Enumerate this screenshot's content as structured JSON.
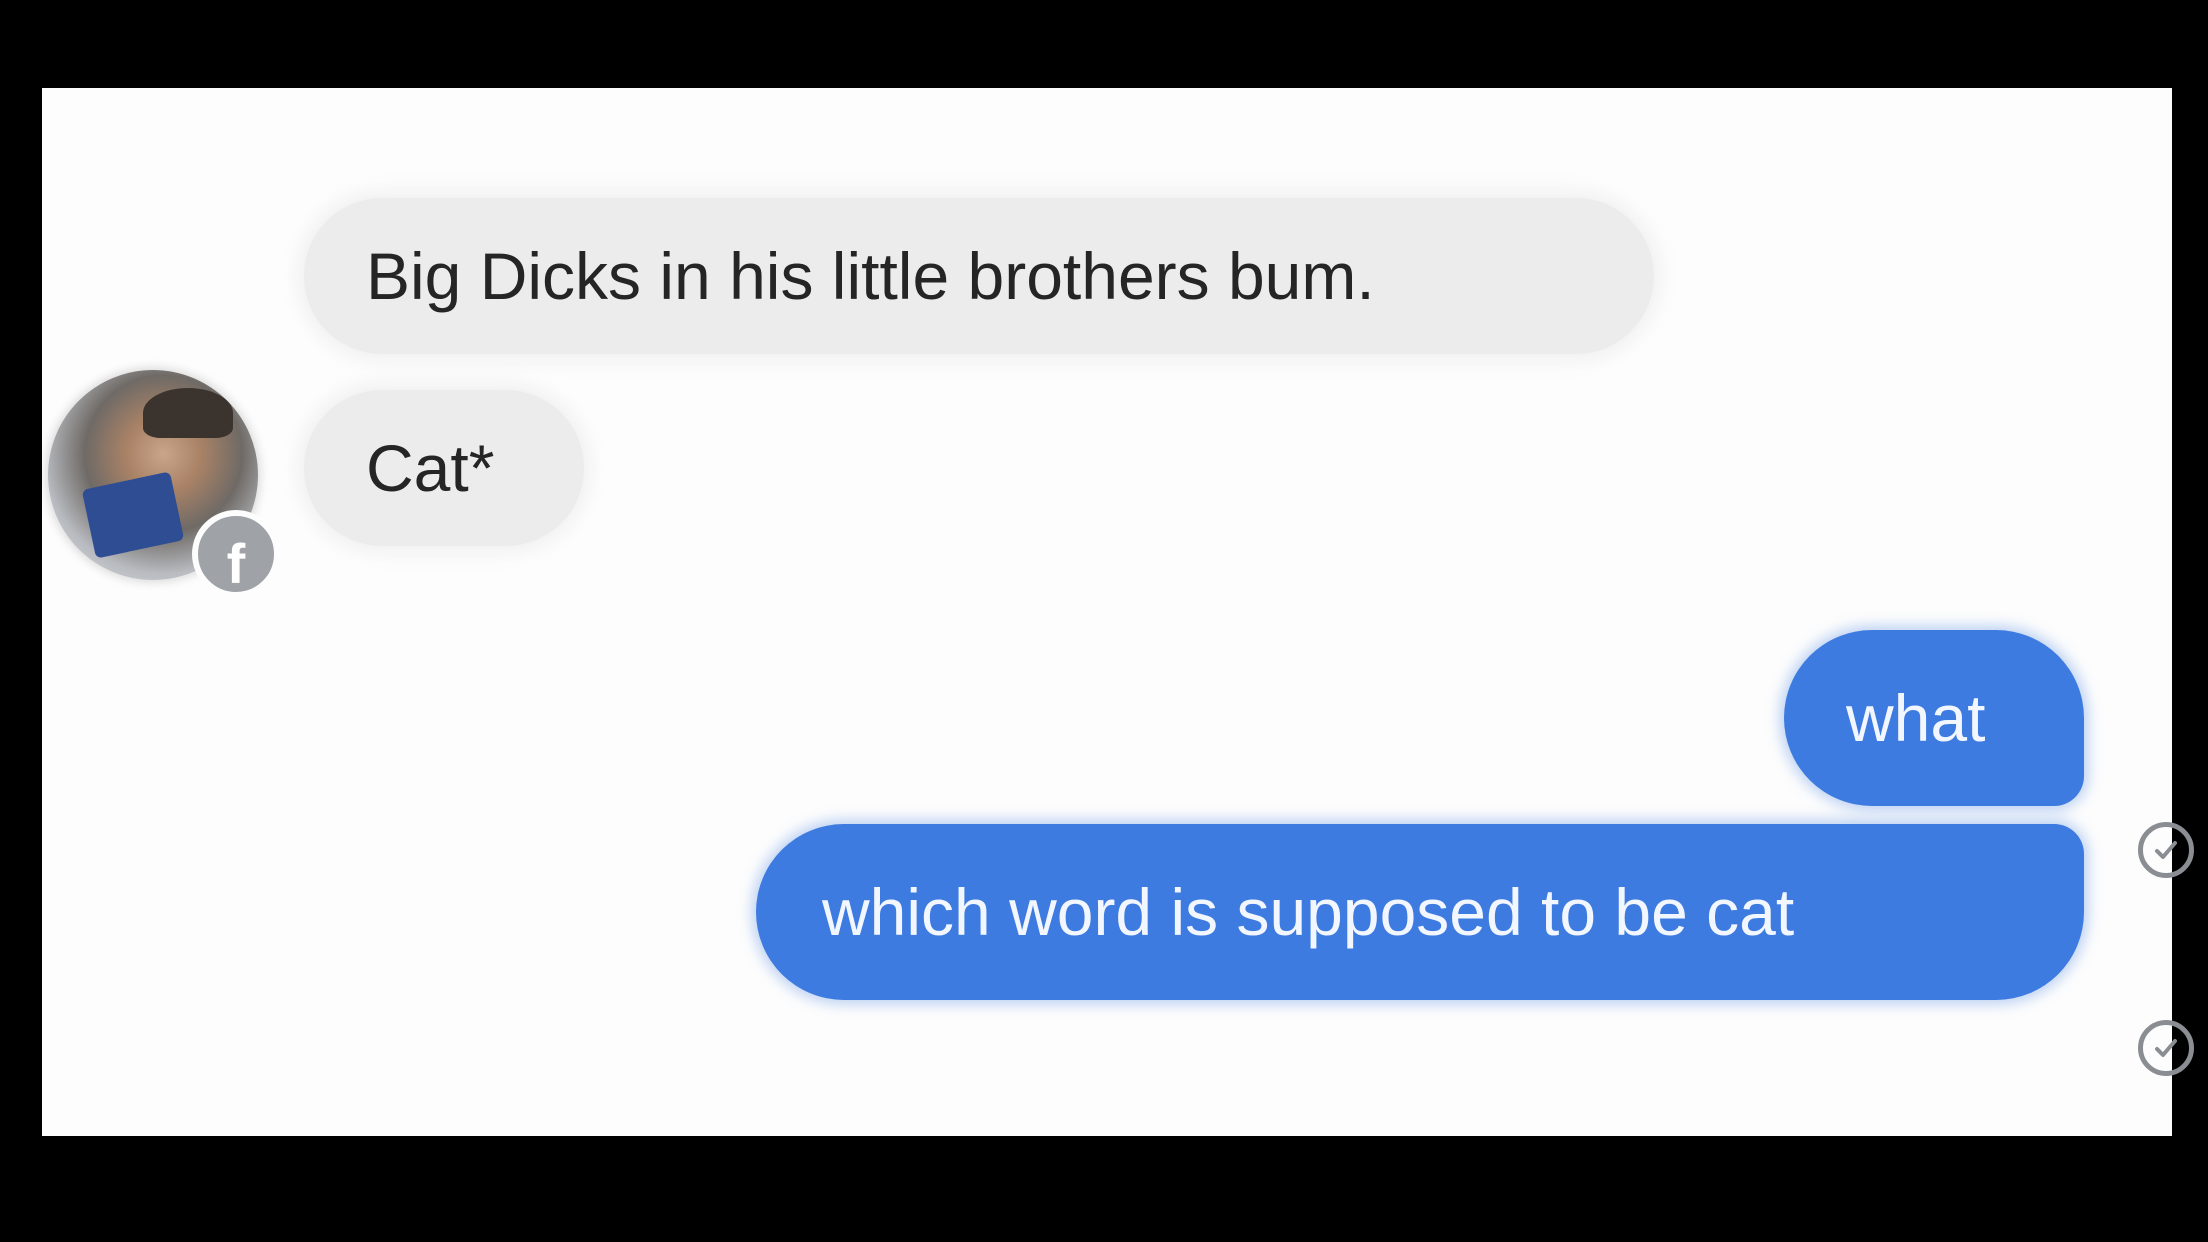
{
  "conversation": {
    "messages": [
      {
        "direction": "incoming",
        "text": "Big Dicks in his little brothers bum."
      },
      {
        "direction": "incoming",
        "text": "Cat*"
      },
      {
        "direction": "outgoing",
        "text": "what"
      },
      {
        "direction": "outgoing",
        "text": "which word is supposed to be cat"
      }
    ],
    "badge_icon": "facebook-icon",
    "badge_glyph": "f",
    "read_receipt_icon": "check-circle-icon"
  },
  "colors": {
    "outgoing_bubble": "#3d7be0",
    "incoming_bubble": "#ececec",
    "background": "#fdfdfd"
  }
}
